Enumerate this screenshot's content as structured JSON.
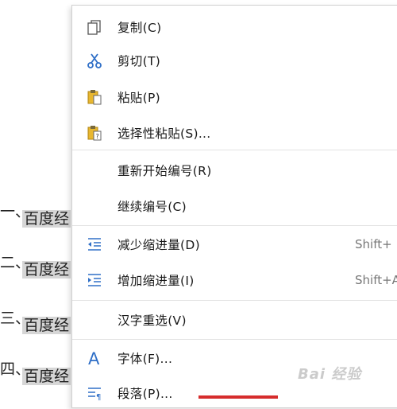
{
  "document": {
    "lines": [
      {
        "number": "一、",
        "selected_text": "百度经"
      },
      {
        "number": "二、",
        "selected_text": "百度经"
      },
      {
        "number": "三、",
        "selected_text": "百度经"
      },
      {
        "number": "四、",
        "selected_text": "百度经"
      }
    ]
  },
  "context_menu": {
    "items": [
      {
        "label": "复制(C)",
        "icon": "copy-icon",
        "shortcut": ""
      },
      {
        "label": "剪切(T)",
        "icon": "scissors-icon",
        "shortcut": ""
      },
      {
        "label": "粘贴(P)",
        "icon": "paste-icon",
        "shortcut": ""
      },
      {
        "label": "选择性粘贴(S)...",
        "icon": "paste-special-icon",
        "shortcut": ""
      },
      {
        "label": "重新开始编号(R)",
        "icon": "",
        "shortcut": ""
      },
      {
        "label": "继续编号(C)",
        "icon": "",
        "shortcut": ""
      },
      {
        "label": "减少缩进量(D)",
        "icon": "decrease-indent-icon",
        "shortcut": "Shift+"
      },
      {
        "label": "增加缩进量(I)",
        "icon": "increase-indent-icon",
        "shortcut": "Shift+A"
      },
      {
        "label": "汉字重选(V)",
        "icon": "",
        "shortcut": ""
      },
      {
        "label": "字体(F)...",
        "icon": "font-icon",
        "shortcut": ""
      },
      {
        "label": "段落(P)...",
        "icon": "paragraph-icon",
        "shortcut": ""
      }
    ]
  },
  "watermark": {
    "text": "Bai 经验"
  },
  "colors": {
    "icon_blue": "#2f6fc7",
    "paste_yellow": "#e8b730",
    "selection": "#d6d6d6",
    "highlight_red": "#d62c2c"
  }
}
